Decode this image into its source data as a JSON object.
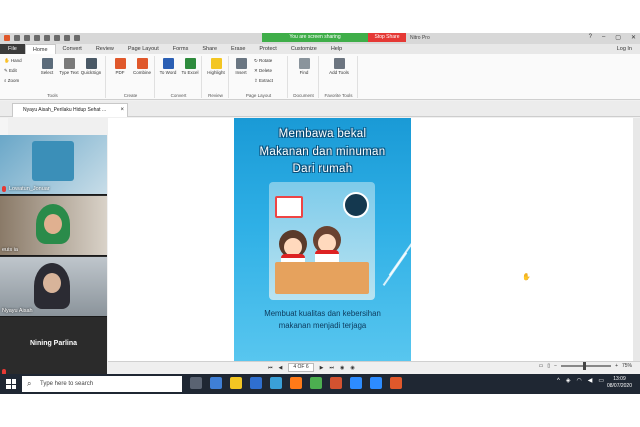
{
  "titlebar": {
    "sharing_text": "You are screen sharing",
    "stop_share_label": "Stop Share",
    "app_title": "Nitro Pro",
    "login_label": "Log In"
  },
  "menubar": {
    "items": [
      "File",
      "Home",
      "Convert",
      "Review",
      "Page Layout",
      "Forms",
      "Share",
      "Erase",
      "Protect",
      "Customize",
      "Help"
    ]
  },
  "ribbon": {
    "tools": {
      "hand": "Hand",
      "edit": "Edit",
      "zoom": "Zoom",
      "select": "Select",
      "type_text": "Type Text",
      "quicksign": "QuickSign",
      "group": "Tools"
    },
    "create": {
      "pdf": "PDF",
      "combine": "Combine",
      "group": "Create"
    },
    "convert": {
      "to_word": "To Word",
      "to_excel": "To Excel",
      "group": "Convert"
    },
    "review": {
      "highlight": "Highlight",
      "group": "Review"
    },
    "page_layout": {
      "insert": "Insert",
      "rotate": "Rotate",
      "delete": "Delete",
      "extract": "Extract",
      "group": "Page Layout"
    },
    "document": {
      "find": "Find",
      "group": "Document"
    },
    "favorite": {
      "add_tools": "Add Tools",
      "group": "Favorite Tools"
    }
  },
  "document_tab": {
    "title": "Nyayu Aisah_Perilaku Hidup Sehat ..."
  },
  "page": {
    "title_lines": [
      "Membawa bekal",
      "Makanan dan minuman",
      "Dari rumah"
    ],
    "caption_lines": [
      "Membuat kualitas dan kebersihan",
      "makanan menjadi terjaga"
    ]
  },
  "navigation": {
    "page_indicator": "4 OF 6",
    "zoom_level": "75%"
  },
  "participants": [
    {
      "name": "Lowatun_Jonuar"
    },
    {
      "name": "euis ia"
    },
    {
      "name": "Nyayu Aisah"
    },
    {
      "name": "Nining Parlina"
    }
  ],
  "taskbar": {
    "search_placeholder": "Type here to search",
    "time": "13:09",
    "date": "08/07/2020"
  }
}
